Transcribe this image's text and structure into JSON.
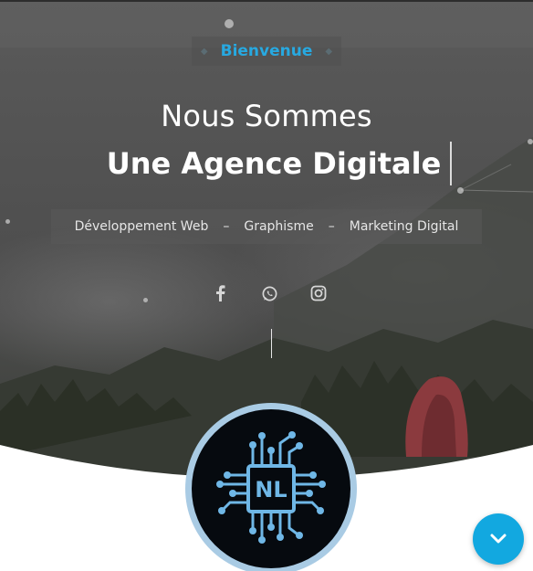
{
  "hero": {
    "welcome": "Bienvenue",
    "line1": "Nous Sommes",
    "line2": "Une Agence Digitale",
    "services": [
      "Développement Web",
      "Graphisme",
      "Marketing Digital"
    ],
    "separator": "–"
  },
  "socials": [
    {
      "name": "facebook-icon"
    },
    {
      "name": "whatsapp-icon"
    },
    {
      "name": "instagram-icon"
    }
  ],
  "logo": {
    "letters": "NL"
  },
  "colors": {
    "accent": "#27a9e1",
    "fab": "#12a8e0",
    "logo_ring": "#a9cbe4"
  },
  "scroll_button": {
    "icon": "chevron-down-icon"
  }
}
